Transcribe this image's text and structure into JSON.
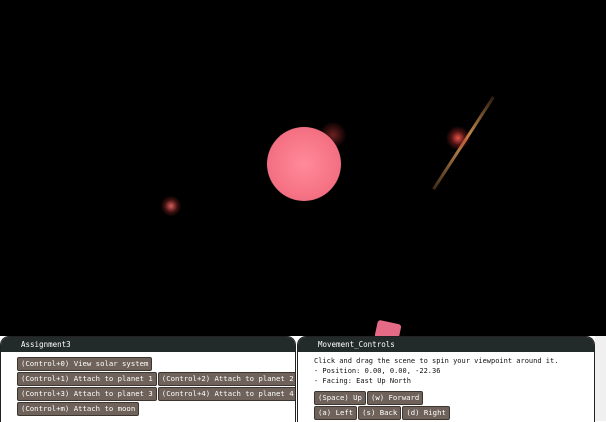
{
  "scene": {
    "background": "#000000",
    "sun_color": "#f57385",
    "moon_color": "#e46a86"
  },
  "left_panel": {
    "title": "Assignment3",
    "rows": [
      [
        "(Control+0) View solar system"
      ],
      [
        "(Control+1) Attach to planet 1",
        "(Control+2) Attach to planet 2"
      ],
      [
        "(Control+3) Attach to planet 3",
        "(Control+4) Attach to planet 4"
      ],
      [
        "(Control+m) Attach to moon"
      ]
    ]
  },
  "right_panel": {
    "title": "Movement_Controls",
    "info_lines": [
      "Click and drag the scene to spin your viewpoint around it.",
      "- Position: 0.00, 0.00, -22.36",
      "- Facing: East Up North"
    ],
    "rows": [
      [
        "(Space) Up",
        "(w) Forward"
      ],
      [
        "(a) Left",
        "(s) Back",
        "(d) Right"
      ]
    ]
  },
  "colors": {
    "button_bg": "#6e625a",
    "header_bg": "#222a2a"
  }
}
